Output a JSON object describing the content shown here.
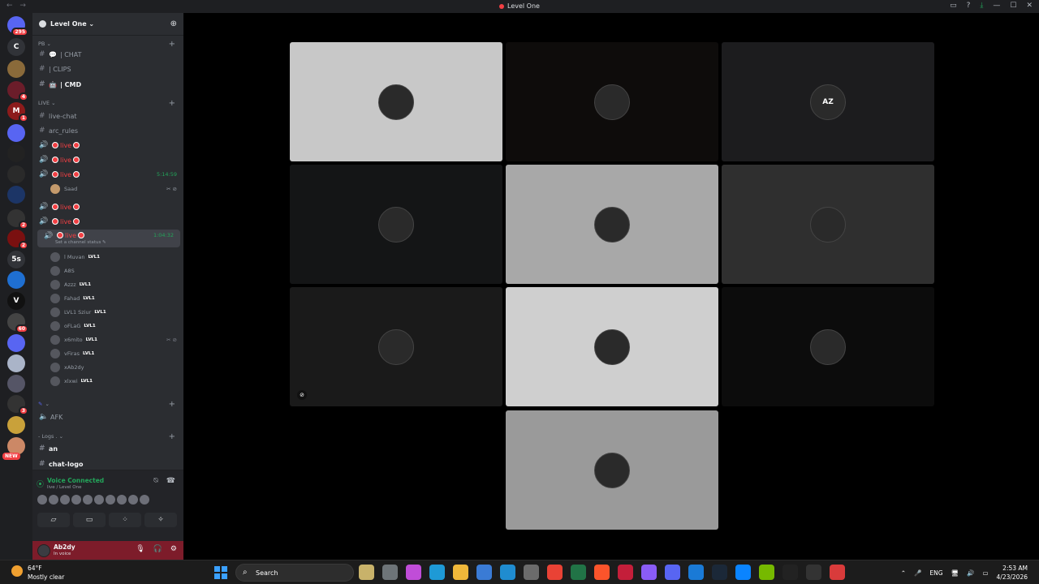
{
  "window": {
    "title": "Level One",
    "nav": "← →",
    "controls": [
      "▭",
      "?",
      "⤓",
      "—",
      "☐",
      "✕"
    ]
  },
  "rail": {
    "servers": [
      {
        "label": "",
        "color": "#5865f2",
        "badge": "295"
      },
      {
        "label": "C",
        "color": "#313338",
        "badge": ""
      },
      {
        "label": "",
        "color": "#8a6a3a",
        "badge": ""
      },
      {
        "label": "",
        "color": "#6b1d2a",
        "badge": "4"
      },
      {
        "label": "M",
        "color": "#8c1b1b",
        "badge": "1"
      },
      {
        "label": "",
        "color": "#5865f2",
        "badge": ""
      },
      {
        "label": "",
        "color": "#222",
        "badge": ""
      },
      {
        "label": "",
        "color": "#2a2a2a",
        "badge": ""
      },
      {
        "label": "",
        "color": "#1c3566",
        "badge": ""
      },
      {
        "label": "",
        "color": "#333",
        "badge": "2"
      },
      {
        "label": "",
        "color": "#7a1010",
        "badge": "2"
      },
      {
        "label": "5s",
        "color": "#313338",
        "badge": ""
      },
      {
        "label": "",
        "color": "#1f6fd1",
        "badge": ""
      },
      {
        "label": "V",
        "color": "#111",
        "badge": ""
      },
      {
        "label": "",
        "color": "#444",
        "badge": "60"
      },
      {
        "label": "",
        "color": "#5865f2",
        "badge": ""
      },
      {
        "label": "",
        "color": "#aab4c8",
        "badge": ""
      },
      {
        "label": "",
        "color": "#556",
        "badge": ""
      },
      {
        "label": "",
        "color": "#333",
        "badge": "3"
      },
      {
        "label": "",
        "color": "#c9a13a",
        "badge": ""
      },
      {
        "label": "",
        "color": "#cc8866",
        "badge": "",
        "tag": "NEW"
      }
    ]
  },
  "sidebar": {
    "server_name": "Level One ⌄",
    "add_icon": "⊕",
    "categories": {
      "pb": "PB ⌄",
      "live": "LIVE ⌄",
      "misc": "⌄",
      "logs": "- Logs . ⌄"
    },
    "text_channels_pb": [
      "| CHAT",
      "| CLIPS",
      "| CMD"
    ],
    "text_channels_live": [
      "live-chat",
      "arc_rules"
    ],
    "live_label": "live",
    "timer1": "5:14:59",
    "timer2": "1:04:32",
    "solo_user": "Saad",
    "status_note": "Set a channel status ✎",
    "voice_users": [
      {
        "name": "l Muvan",
        "badge": "LVL1"
      },
      {
        "name": "A8S",
        "badge": ""
      },
      {
        "name": "Azzz",
        "badge": "LVL1"
      },
      {
        "name": "Fahad",
        "badge": "LVL1"
      },
      {
        "name": "LVL1 Sziur",
        "badge": "LVL1"
      },
      {
        "name": "oFLaG",
        "badge": "LVL1"
      },
      {
        "name": "x6mito",
        "badge": "LVL1"
      },
      {
        "name": "vFiras",
        "badge": "LVL1"
      },
      {
        "name": "xAb2dy",
        "badge": ""
      },
      {
        "name": "xlxwi",
        "badge": "LVL1"
      }
    ],
    "afk": "AFK",
    "log_channels": [
      "an",
      "chat-logo"
    ]
  },
  "voice": {
    "title": "Voice Connected",
    "subtitle": "live / Level One",
    "buttons": [
      "▱",
      "▭",
      "⁘",
      "✧"
    ]
  },
  "user": {
    "name": "Ab2dy",
    "status": "In voice"
  },
  "tiles": [
    {
      "bg": "#c8c8c8",
      "label": ""
    },
    {
      "bg": "#0e0c0b",
      "label": ""
    },
    {
      "bg": "#1c1c1e",
      "label": "AZ"
    },
    {
      "bg": "#141516",
      "label": ""
    },
    {
      "bg": "#a8a8a8",
      "label": ""
    },
    {
      "bg": "#2f2f2f",
      "label": ""
    },
    {
      "bg": "#1a1a1a",
      "label": ""
    },
    {
      "bg": "#cfcfcf",
      "label": ""
    },
    {
      "bg": "#0c0c0c",
      "label": ""
    },
    {
      "bg": "#9a9a9a",
      "label": ""
    }
  ],
  "taskbar": {
    "temp": "64°F",
    "condition": "Mostly clear",
    "search_placeholder": "Search",
    "apps": [
      "#c8b26a",
      "#6e7478",
      "#c04dd8",
      "#1e9ad6",
      "#f0b83a",
      "#3a7bd5",
      "#1f8cd0",
      "#6b6b6b",
      "#e94235",
      "#217346",
      "#fb542b",
      "#c41e3a",
      "#8a5cf6",
      "#5865f2",
      "#1a7ad6",
      "#1b2838",
      "#0a84ff",
      "#76b900",
      "#222",
      "#333",
      "#d93b3b"
    ],
    "lang": "ENG",
    "time": "2:53 AM",
    "date": "4/23/2026"
  }
}
